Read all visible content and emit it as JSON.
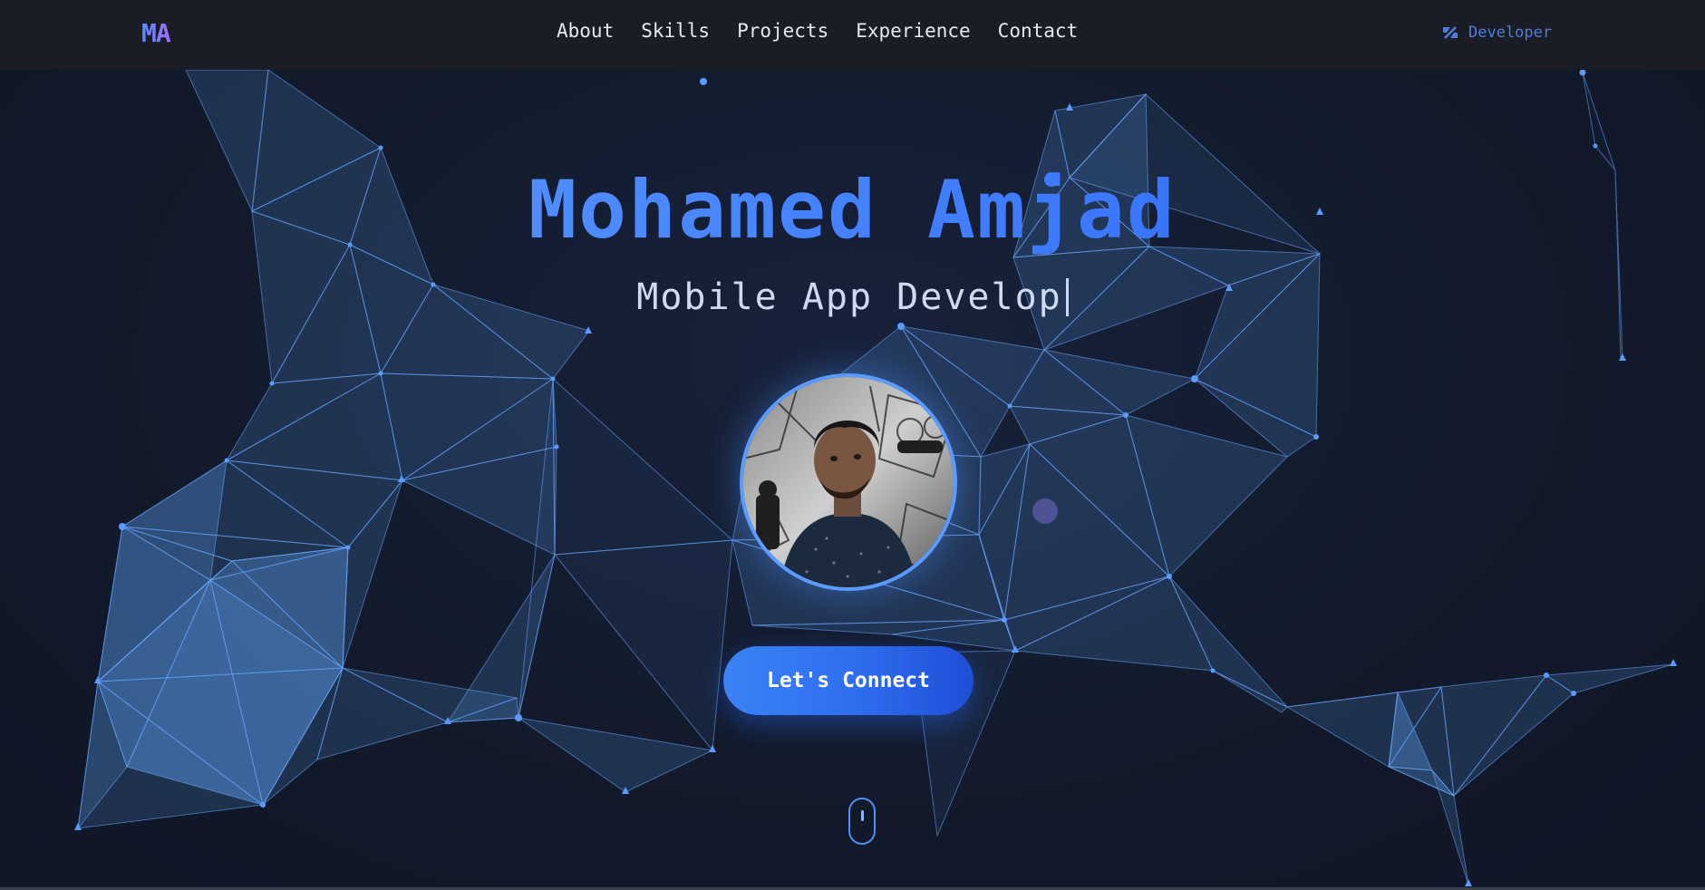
{
  "nav": {
    "logo": "MA",
    "links": [
      "About",
      "Skills",
      "Projects",
      "Experience",
      "Contact"
    ],
    "badge_label": "Developer",
    "badge_icon": "code-brackets-icon"
  },
  "hero": {
    "name": "Mohamed Amjad",
    "role_typed": "Mobile App Develop",
    "cta_label": "Let's Connect",
    "scroll_icon": "mouse-scroll-icon"
  },
  "colors": {
    "background": "#141b2b",
    "navbar": "#1a1c26",
    "accent": "#3b82f6",
    "network": "#60a5fa"
  }
}
